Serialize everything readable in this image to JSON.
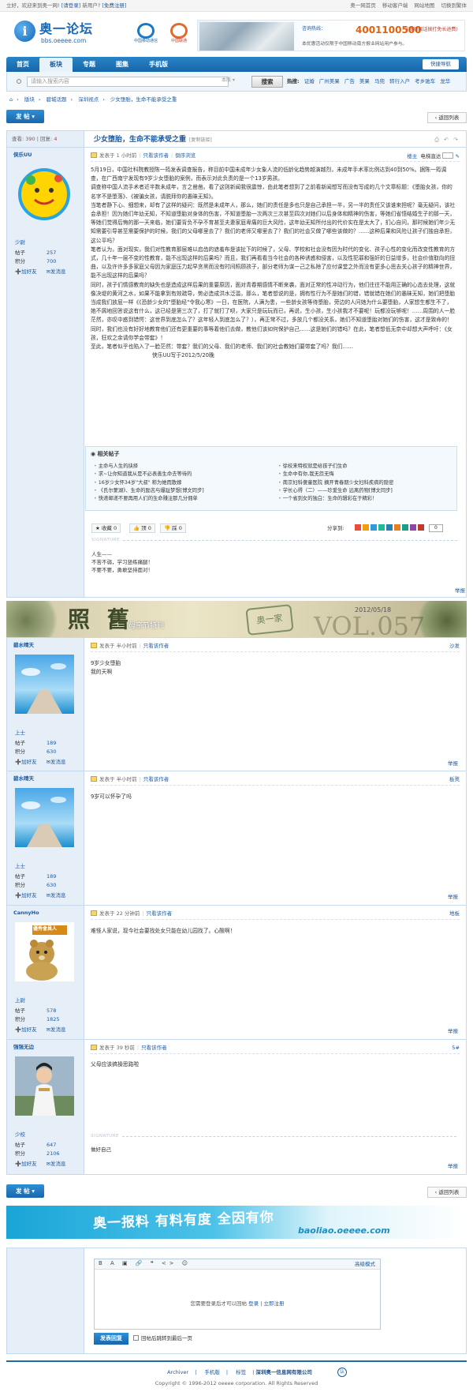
{
  "topbar": {
    "greeting": "立好，欢迎来到奥一网!",
    "login": "[请登录]",
    "new_user": "新用户?",
    "register": "[免费注册]",
    "links": [
      "奥一网首页",
      "移动客户端",
      "网站地图",
      "切换到繁体"
    ]
  },
  "header": {
    "logo_text": "奥一论坛",
    "logo_url": "bbs.oeeee.com",
    "brand1": "中国移动通信",
    "brand2": "中国联通",
    "ad_line1": "咨询热线：",
    "ad_phone": "4001100500",
    "ad_line2": "(移动固话拨打免长途费)",
    "ad_line3": "本优惠活动仅限于中国移动南方报业网站用户参与。"
  },
  "nav": {
    "items": [
      "首页",
      "板块",
      "专题",
      "图集",
      "手机版"
    ],
    "quick": "快捷导航"
  },
  "search": {
    "placeholder": "请输入搜索内容",
    "scope": "本版",
    "button": "搜索",
    "hot_label": "热搜:",
    "hot": [
      "证婚",
      "广州美果",
      "广告",
      "美果",
      "马兜",
      "转行入户",
      "考乡驰车",
      "龙华"
    ]
  },
  "breadcrumb": [
    "版块",
    "碧城话题",
    "深圳视点",
    "少女堕胎，生命不能承受之重"
  ],
  "actions": {
    "post": "发 帖",
    "back": "返回列表"
  },
  "thread": {
    "views_label": "查看:",
    "views": "390",
    "replies_label": "回复:",
    "replies": "4",
    "title": "少女堕胎，生命不能承受之重",
    "title_tag": "[复制链接]"
  },
  "posts": [
    {
      "author": "侠乐UU",
      "rank": "少尉",
      "posts_label": "帖子",
      "posts": "257",
      "points_label": "积分",
      "points": "700",
      "add_friend": "加好友",
      "send_msg": "发消息",
      "time": "发表于 1 小时前",
      "only_author": "只看该作者",
      "reverse": "倒序浏览",
      "floor": "楼主",
      "floor_extra": "电梯直达",
      "paragraphs": [
        "5月19日，中国社科院教授陈一筠发表调查报告，称目前中国未成年少女象人流的低龄化趋势越演越烈，未成年手术率比例达到40到50%。据陈一筠调查，在广西南宁发现有9岁少女堕胎的案例，而表示对此负责的是一个13岁男孩。",
        "调查称中国人流手术者近半数未成年，言之凿凿。看了这则新闻我很震惊，由此笔者想到了之前看新闻想写而没有写成的几个文章标题：《堕胎女孩，你的名字不是堕落》、《被骗女孩，请脱拜你的愚昧无知》。",
        "当笔者静下心、细想来，却有了这样的疑问：既然是未成年人，那么，她们的责任是多也只是自己承担一半，另一半的责任又该谁来担呢？毫无疑问，该社会承担！因为她们年幼无知，不知道堕胎对身体的伤害，不知道堕胎一次两次三次甚至四次对她们以后身体和精神的伤害，等她们省悟结婚生子的那一天，等她们觉得后悔的那一天来临，她们要背负不孕不育甚至夫妻家庭卑痛的巨大风险，这年幼无知所付出的代价实在是太大了，扪心自问，那时候她们年少无知需要引导甚至需要保护的时候，我们的父母哪里去了？我们的老师又哪里去了？我们的社会又做了哪些该做的？……这种后果和风险让孩子们独自承担，这公平吗？",
        "笔者认为，面对现实，我们对性教育那层难以启齿的遮羞布是该扯下的时候了，父母、学校和社会没有因为时代的变化、孩子心性的变化而改变性教育的方式，几十年一层不变的性教育，能不出现这样的后果吗？而且，我们再看看当今社会的各种诱惑和侵害，以及性犯罪和强奸的日益增多，社会价值取向的扭曲，以及许许多多家庭父母因为家庭压力起早贪黑而没有时间照顾孩子，部分老师为谋一己之私除了应付课堂之外而没有更多心思去关心孩子的精神世界，能不出现这样的后果吗？",
        "同时，孩子们情感教育的缺失也是造成这样后果的重要原因，面对青春期感情不断来袭，面对正常的性冲动行为，他们往往不能用正确的心态去处理，这就像决堤的黄河之水，如果不能拿到有效疏导，势必造成洪水泛滥，那么，笔者想说的是，拥有性行为不是她们的错，错就错在她们的愚昧无知，她们把堕胎当成我们放屁一样《《恐龄少女的\"堕胎经\"令我心寒》一日，在医院，人满为患，一些龄女孩等待堕胎，旁边的人问她为什么要堕胎，人家想生都生不了，她不屑地回答说这有什么，这已经是第三次了，打了就打了呗，大家只是玩玩而已，再说，生小孩，生小孩我才不要呢！玩都没玩够呢！……周围的人一脸茫然，亦叹中惑到错愕：这世界到底怎么了？这年轻人到底怎么了？），再正常不过，多放几个都没关系，她们不知道堕胎对她们的伤害，这才是致命的！同时，我们也没有好好地教育他们还有更重要的事等着他们去做，教他们该如何保护自己……这是她们的错吗？在此，笔者想低无奈中却想大声呼吁：《女孩，狂欢之余请你学会带套》！",
        "至此，笔者似乎也陷入了一脸茫然：带套？我们的父母、我们的老师、我们的社会教她们要带套了吗？我们……"
      ],
      "signoff": "侠乐UU写于2012/5/20晚",
      "related_title": "相关帖子",
      "related_left": [
        "主命与人生的抉择",
        "求~让你知道我从是不必表善生命去等待的",
        "16岁少女怀34岁\"大叔\" 称为她而散嫁",
        "《氏尔蒙湖》、生命的励志与爆趾梦想[博文同步]",
        "快递邮递不要再用人们的生命赚注那几分佣单"
      ],
      "related_right": [
        "徐校来特权就是给孩子们生命",
        "生命中有你,我无怨无悔",
        "南京妇科傻童医院 摘开青春期少女妇科疾病的隐密",
        "学长心得（二）——珍爱生命 远离药物[博文同步]",
        "一个省到女的独白：生命的辑彩在于精彩！"
      ],
      "rate_fav": "收藏 0",
      "rate_up": "顶 0",
      "rate_down": "踩 0",
      "share_label": "分享到:",
      "share_count": "0",
      "sig": [
        "人生——",
        "不苦不弱，学习竖练痛腿！",
        "不要不要，勇敢坚持面对！"
      ],
      "report": "举报"
    },
    {
      "author": "碧水晴天",
      "rank": "上士",
      "posts_label": "帖子",
      "posts": "189",
      "points_label": "积分",
      "points": "630",
      "add_friend": "加好友",
      "send_msg": "发消息",
      "time": "发表于 半小时前",
      "only_author": "只看该作者",
      "floor": "沙发",
      "lines": [
        "9岁少女堕胎",
        "我的天啊"
      ],
      "report": "举报"
    },
    {
      "author": "碧水晴天",
      "rank": "上士",
      "posts_label": "帖子",
      "posts": "189",
      "points_label": "积分",
      "points": "630",
      "add_friend": "加好友",
      "send_msg": "发消息",
      "time": "发表于 半小时前",
      "only_author": "只看该作者",
      "floor": "板凳",
      "lines": [
        "9岁可以怀孕了吗"
      ],
      "report": "举报"
    },
    {
      "author": "CannyHo",
      "rank": "上尉",
      "posts_label": "帖子",
      "posts": "578",
      "points_label": "积分",
      "points": "1825",
      "add_friend": "加好友",
      "send_msg": "发消息",
      "time": "发表于 22 分钟前",
      "only_author": "只看该作者",
      "floor": "地板",
      "avatar_text": "優秀會員人",
      "lines": [
        "难怪人家说，现今社会要找处女只能在幼儿园找了。心酸啊！"
      ],
      "report": "举报"
    },
    {
      "author": "强强无边",
      "rank": "少校",
      "posts_label": "帖子",
      "posts": "647",
      "points_label": "积分",
      "points": "2106",
      "add_friend": "加好友",
      "send_msg": "发消息",
      "time": "发表于 39 秒前",
      "only_author": "只看该作者",
      "floor": "5#",
      "lines": [
        "父母应该搞操思路啦"
      ],
      "sig": [
        "做好自己"
      ],
      "report": "举报"
    }
  ],
  "signature_label": "SIGNATURE",
  "ad_strip": {
    "big": "照 舊",
    "sub": "母亲节特刊",
    "stamp": "奥一家",
    "vol": "VOL.057",
    "date": "2012/05/18"
  },
  "ad_bottom": {
    "title": "奥一报料 有料有度 全因有你",
    "url": "baoliao.oeeee.com"
  },
  "reply": {
    "toolbar": "B A ▣ 🔗 ❝ <> ☺",
    "advanced": "高级模式",
    "msg_prefix": "您需要登录后才可以回帖",
    "login": "登录",
    "sep": " | ",
    "register": "立即注册",
    "submit": "发表回复",
    "jump": "回帖后跳转到最后一页"
  },
  "footer": {
    "links": [
      "Archiver",
      "手机版",
      "标签"
    ],
    "company": "深圳奥一信息网有限公司",
    "copyright": "Copyright © 1996-2012 oeeee corporation. All Rights Reserved"
  },
  "colors": {
    "brand_blue": "#1a69b5",
    "nav_blue": "#1f6bb0",
    "side_bg": "#e6eff8",
    "alert_red": "#e03030"
  }
}
